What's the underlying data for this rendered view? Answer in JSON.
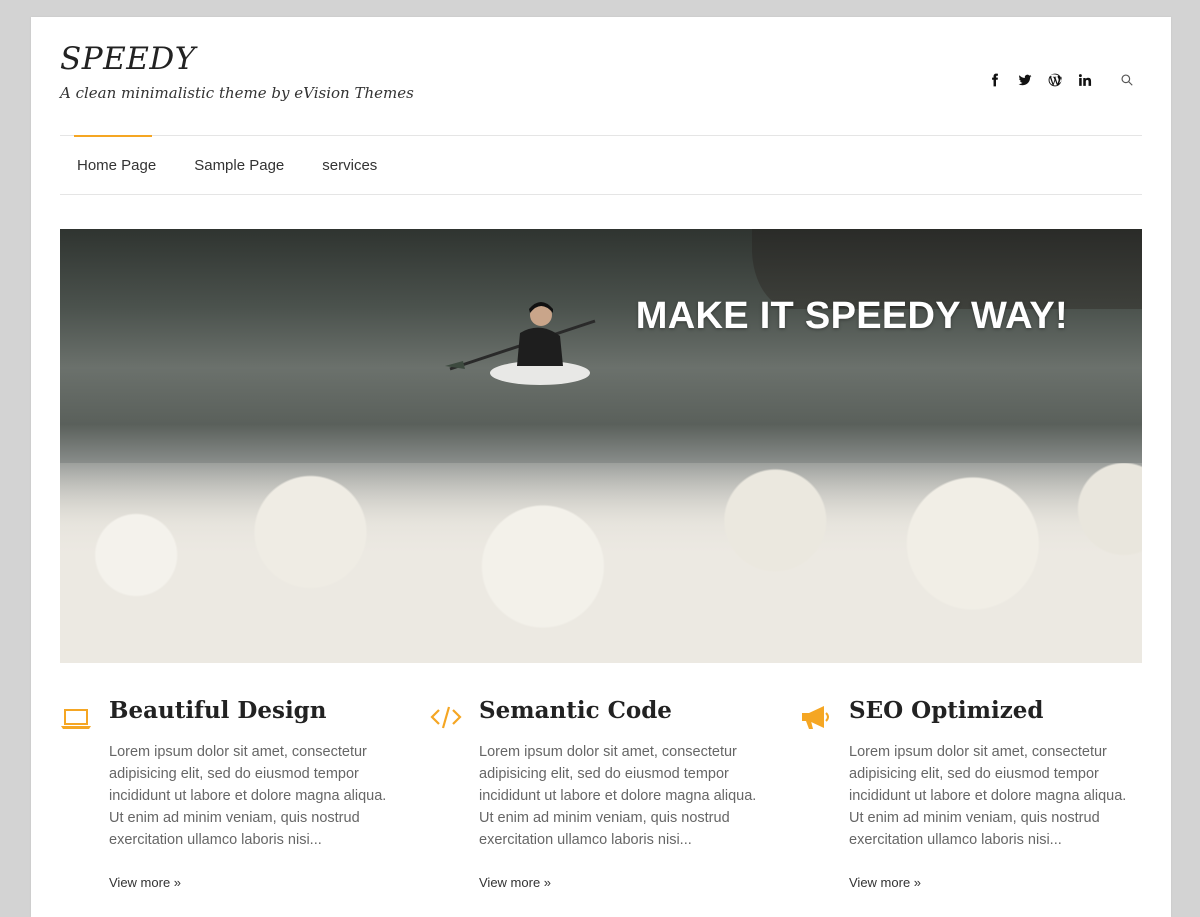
{
  "site": {
    "title": "SPEEDY",
    "tagline": "A clean minimalistic theme by eVision Themes"
  },
  "header": {
    "social_icons": [
      "facebook-icon",
      "twitter-icon",
      "wordpress-icon",
      "linkedin-icon"
    ],
    "search_icon": "search-icon"
  },
  "nav": {
    "items": [
      {
        "label": "Home Page",
        "active": true
      },
      {
        "label": "Sample Page",
        "active": false
      },
      {
        "label": "services",
        "active": false
      }
    ]
  },
  "hero": {
    "headline": "MAKE IT SPEEDY WAY!"
  },
  "features": [
    {
      "icon": "laptop-icon",
      "title": "Beautiful Design",
      "text": "Lorem ipsum dolor sit amet, consectetur adipisicing elit, sed do eiusmod tempor incididunt ut labore et dolore magna aliqua. Ut enim ad minim veniam, quis nostrud exercitation ullamco laboris nisi...",
      "link": "View more »"
    },
    {
      "icon": "code-icon",
      "title": "Semantic Code",
      "text": "Lorem ipsum dolor sit amet, consectetur adipisicing elit, sed do eiusmod tempor incididunt ut labore et dolore magna aliqua. Ut enim ad minim veniam, quis nostrud exercitation ullamco laboris nisi...",
      "link": "View more »"
    },
    {
      "icon": "megaphone-icon",
      "title": "SEO Optimized",
      "text": "Lorem ipsum dolor sit amet, consectetur adipisicing elit, sed do eiusmod tempor incididunt ut labore et dolore magna aliqua. Ut enim ad minim veniam, quis nostrud exercitation ullamco laboris nisi...",
      "link": "View more »"
    }
  ],
  "colors": {
    "accent": "#f5a623",
    "background": "#d3d3d3",
    "page": "#ffffff"
  }
}
